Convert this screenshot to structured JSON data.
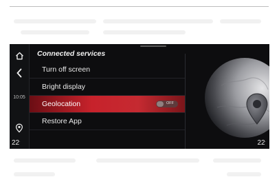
{
  "header": {
    "title": "Connected services"
  },
  "rail": {
    "time": "10:05",
    "temp_left": "22",
    "temp_unit": "."
  },
  "menu": {
    "items": [
      {
        "label": "Turn off screen"
      },
      {
        "label": "Bright display"
      },
      {
        "label": "Geolocation",
        "toggle_state": "OFF"
      },
      {
        "label": "Restore App"
      }
    ]
  },
  "status": {
    "temp_right": "22"
  },
  "colors": {
    "screen_bg": "#0d0d0f",
    "selected_red": "#c7222b",
    "text": "#eaeaea"
  },
  "icons": [
    "home-icon",
    "back-arrow-icon",
    "navigation-pin-icon",
    "globe-map-icon",
    "location-pin-icon"
  ]
}
